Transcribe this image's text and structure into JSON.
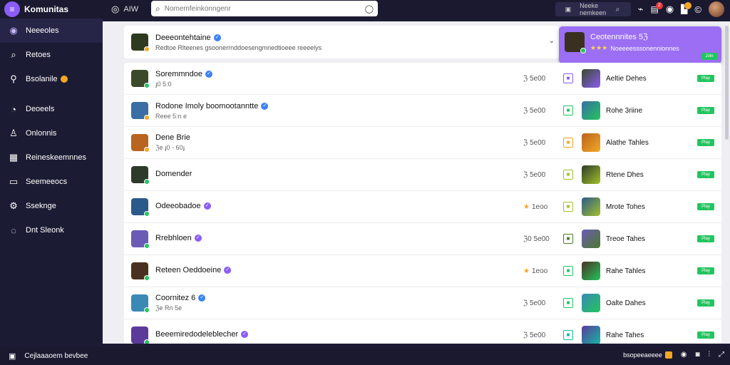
{
  "app": {
    "name": "Komunitas",
    "switch_label": "AIW"
  },
  "search": {
    "placeholder": "Nomemfeinkonngenr"
  },
  "topbar": {
    "mini_search": "Neeke nemkeen",
    "notif_count": "2"
  },
  "sidebar": {
    "items": [
      {
        "label": "Neeeoles",
        "icon": "community-icon",
        "glyph": "◉",
        "active": true
      },
      {
        "label": "Retoes",
        "icon": "search-icon",
        "glyph": "⌕"
      },
      {
        "label": "Bsolanile",
        "icon": "wrench-icon",
        "glyph": "⚲"
      },
      {
        "label": "Deoeels",
        "icon": "chart-icon",
        "glyph": "◔"
      },
      {
        "label": "Onlonnis",
        "icon": "user-icon",
        "glyph": "♙"
      },
      {
        "label": "Reineskeemnnes",
        "icon": "grid-icon",
        "glyph": "▦"
      },
      {
        "label": "Seemeeocs",
        "icon": "panel-icon",
        "glyph": "▭"
      },
      {
        "label": "Sseknge",
        "icon": "tools-icon",
        "glyph": "⚙"
      },
      {
        "label": "Dnt Sleonk",
        "icon": "help-icon",
        "glyph": "◌"
      }
    ]
  },
  "featured": {
    "title": "Deeeontehtaine",
    "subtitle": "Redtoe Rlteenes ɡsoonerrnddoesengmnedtioeee reeeelys"
  },
  "popup": {
    "title": "Ceotennnites 5ℨ",
    "subtitle": "Noeeeesssonennionnes",
    "stars": "★★★",
    "button": "Join"
  },
  "rows": [
    {
      "name": "Soremmndoe",
      "meta": "ɟ0 5:0",
      "verified": "blue",
      "count": "ℨ 5e00",
      "star": false,
      "game": "Aeltie Dehes",
      "sq_color": "#8b5cf6",
      "status": "#22c55e",
      "thumb": "#3a4a2a"
    },
    {
      "name": "Rodone Imoly boomootanntte",
      "meta": "Reee 5:n e",
      "verified": "blue",
      "count": "ℨ 5e00",
      "star": false,
      "game": "Rohe 3riine",
      "sq_color": "#22c55e",
      "status": "#f5a623",
      "thumb": "#3a6ea5"
    },
    {
      "name": "Dene Brie",
      "meta": "ℨe ɟ0 - 60ɟ",
      "verified": "",
      "count": "ℨ 5e00",
      "star": false,
      "game": "Alathe Tahles",
      "sq_color": "#f5a623",
      "status": "#f5a623",
      "thumb": "#b8651f"
    },
    {
      "name": "Domender",
      "meta": "",
      "verified": "",
      "count": "ℨ 5e00",
      "star": false,
      "game": "Rtene Dhes",
      "sq_color": "#a3c02a",
      "status": "#22c55e",
      "thumb": "#2d3a2a"
    },
    {
      "name": "Odeeobadoe",
      "meta": "",
      "verified": "purple",
      "count": "1eoo",
      "star": true,
      "game": "Mrote Tohes",
      "sq_color": "#a3c02a",
      "status": "#22c55e",
      "thumb": "#2a5a8a"
    },
    {
      "name": "Rrebhloen",
      "meta": "",
      "verified": "purple",
      "count": "ℨ0 5e00",
      "star": false,
      "game": "Treoe Tahes",
      "sq_color": "#4c7a2a",
      "status": "#22c55e",
      "thumb": "#6b5bb5"
    },
    {
      "name": "Reteen Oeddoeine",
      "meta": "",
      "verified": "purple",
      "count": "1eoo",
      "star": true,
      "game": "Rahe Tahles",
      "sq_color": "#22c55e",
      "status": "#22c55e",
      "thumb": "#4a3020"
    },
    {
      "name": "Coornitez 6",
      "meta": "ℨe Rn 5e",
      "verified": "blue",
      "count": "ℨ 5e00",
      "star": false,
      "game": "Oalte Dahes",
      "sq_color": "#22c55e",
      "status": "#22c55e",
      "thumb": "#3a8ab5"
    },
    {
      "name": "Beeemiredodeleblecher",
      "meta": "",
      "verified": "purple",
      "count": "ℨ 5e00",
      "star": false,
      "game": "Rahe Tahes",
      "sq_color": "#14b8a6",
      "status": "#22c55e",
      "thumb": "#5b3a9a"
    }
  ],
  "play_label": "Play",
  "bottombar": {
    "left_text": "Cejlaaaoem bevbee",
    "right_text": "bsopeeaeeee"
  },
  "colors": {
    "accent": "#8b5cf6",
    "bar": "#1a1930",
    "sidebar": "#1c1b34",
    "bg": "#efeff3",
    "play": "#22c55e"
  }
}
